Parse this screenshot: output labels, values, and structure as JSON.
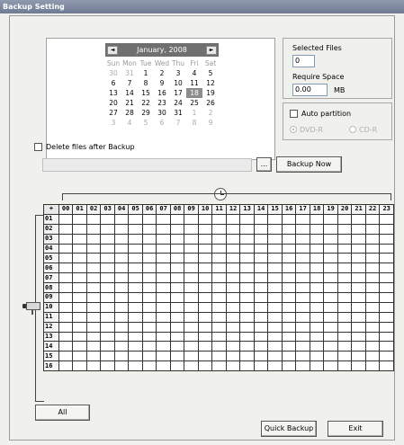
{
  "window": {
    "title": "Backup Setting"
  },
  "calendar": {
    "month_label": "January, 2008",
    "prev_symbol": "◄",
    "next_symbol": "►",
    "weekdays": [
      "Sun",
      "Mon",
      "Tue",
      "Wed",
      "Thu",
      "Fri",
      "Sat"
    ],
    "weeks": [
      [
        "30",
        "31",
        "1",
        "2",
        "3",
        "4",
        "5"
      ],
      [
        "6",
        "7",
        "8",
        "9",
        "10",
        "11",
        "12"
      ],
      [
        "13",
        "14",
        "15",
        "16",
        "17",
        "18",
        "19"
      ],
      [
        "20",
        "21",
        "22",
        "23",
        "24",
        "25",
        "26"
      ],
      [
        "27",
        "28",
        "29",
        "30",
        "31",
        "1",
        "2"
      ],
      [
        "3",
        "4",
        "5",
        "6",
        "7",
        "8",
        "9"
      ]
    ],
    "selected_day": "18"
  },
  "selected_files": {
    "label": "Selected Files",
    "value": "0"
  },
  "require_space": {
    "label": "Require Space",
    "value": "0.00",
    "unit": "MB"
  },
  "auto_partition": {
    "label": "Auto partition",
    "checked": false,
    "options": [
      "DVD-R",
      "CD-R"
    ],
    "selected": "DVD-R"
  },
  "delete_after": {
    "label": "Delete files after Backup",
    "checked": false
  },
  "path": {
    "value": "",
    "browse_label": "..."
  },
  "buttons": {
    "backup_now": "Backup Now",
    "all": "All",
    "quick_backup": "Quick Backup",
    "exit": "Exit"
  },
  "schedule": {
    "corner_label": "+",
    "hours": [
      "00",
      "01",
      "02",
      "03",
      "04",
      "05",
      "06",
      "07",
      "08",
      "09",
      "10",
      "11",
      "12",
      "13",
      "14",
      "15",
      "16",
      "17",
      "18",
      "19",
      "20",
      "21",
      "22",
      "23"
    ],
    "channels": [
      "01",
      "02",
      "03",
      "04",
      "05",
      "06",
      "07",
      "08",
      "09",
      "10",
      "11",
      "12",
      "13",
      "14",
      "15",
      "16"
    ]
  }
}
